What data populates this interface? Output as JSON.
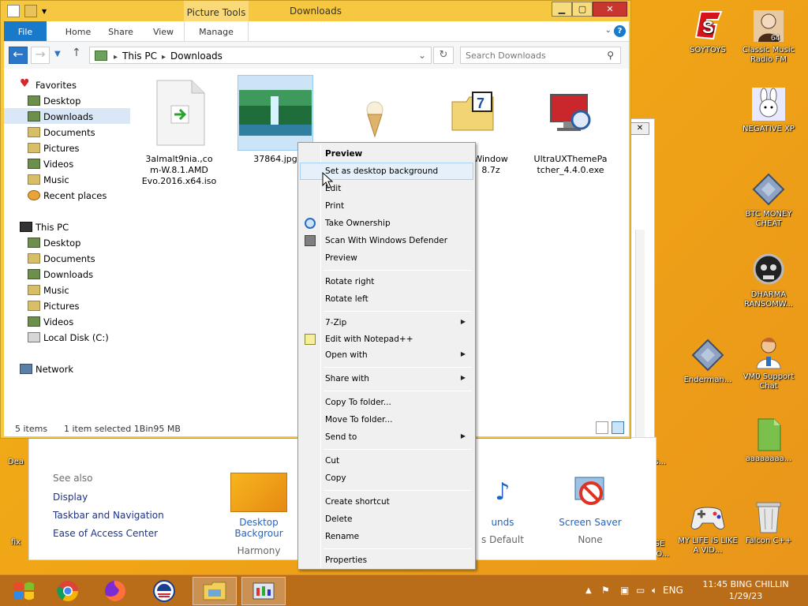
{
  "desktop": {
    "icons": [
      {
        "label": "SOYTOYS",
        "icon": "soytoys-icon"
      },
      {
        "label": "Classic Music Radio FM",
        "icon": "radio-portrait-icon"
      },
      {
        "label": "NEGATIVE XP",
        "icon": "bunny-icon"
      },
      {
        "label": "BTC MONEY CHEAT",
        "icon": "diamond-icon"
      },
      {
        "label": "DHARMA RANSOMW...",
        "icon": "skull-icon"
      },
      {
        "label": "Enderman...",
        "icon": "diamond-icon"
      },
      {
        "label": "VM0 Support Chat",
        "icon": "support-person-icon"
      },
      {
        "label": "aaaaaaaa...",
        "icon": "green-file-icon"
      },
      {
        "label": "MY LIFE IS LIKE A VID...",
        "icon": "gamepad-icon"
      },
      {
        "label": "Falcon C++",
        "icon": "recycle-bin-icon"
      },
      {
        "label": "fix",
        "icon": ""
      },
      {
        "label": "Dea",
        "icon": ""
      },
      {
        "label": "E.s...",
        "icon": ""
      },
      {
        "label": "SE",
        "icon": ""
      },
      {
        "label": "DO...",
        "icon": ""
      }
    ]
  },
  "control_panel": {
    "see_also": "See also",
    "links": [
      "Display",
      "Taskbar and Navigation",
      "Ease of Access Center"
    ],
    "items": [
      {
        "title": "Desktop Backgrour",
        "sub": "Harmony"
      },
      {
        "title": "unds",
        "sub": "s Default"
      },
      {
        "title": "Screen Saver",
        "sub": "None"
      }
    ]
  },
  "explorer": {
    "window_title": "Downloads",
    "contextual_tab_group": "Picture Tools",
    "ribbon_tabs": [
      "File",
      "Home",
      "Share",
      "View",
      "Manage"
    ],
    "address": {
      "root": "This PC",
      "current": "Downloads"
    },
    "search_placeholder": "Search Downloads",
    "nav": {
      "favorites": "Favorites",
      "favorites_items": [
        "Desktop",
        "Downloads",
        "Documents",
        "Pictures",
        "Videos",
        "Music",
        "Recent places"
      ],
      "this_pc": "This PC",
      "this_pc_items": [
        "Desktop",
        "Documents",
        "Downloads",
        "Music",
        "Pictures",
        "Videos",
        "Local Disk (C:)"
      ],
      "network": "Network"
    },
    "files": [
      {
        "name": "3almalt9nia.,co m-W.8.1.AMD Evo.2016.x64.iso",
        "icon": "iso-file-icon"
      },
      {
        "name": "37864.jpg",
        "icon": "waterfall-image-icon"
      },
      {
        "name": "",
        "icon": "ice-cream-image-icon"
      },
      {
        "name": "Window 8.7z",
        "icon": "7zip-archive-icon"
      },
      {
        "name": "UltraUXThemePa tcher_4.4.0.exe",
        "icon": "theme-patcher-icon"
      }
    ],
    "status": {
      "count": "5 items",
      "selected": "1 item selected  1Bin95 MB"
    }
  },
  "context_menu": {
    "groups": [
      [
        {
          "label": "Preview",
          "bold": true
        },
        {
          "label": "Set as desktop background",
          "hover": true
        },
        {
          "label": "Edit"
        },
        {
          "label": "Print"
        },
        {
          "label": "Take Ownership",
          "icon": "ownership-icon"
        },
        {
          "label": "Scan With Windows Defender",
          "icon": "defender-icon"
        },
        {
          "label": "Preview"
        }
      ],
      [
        {
          "label": "Rotate right"
        },
        {
          "label": "Rotate left"
        }
      ],
      [
        {
          "label": "7-Zip",
          "submenu": true
        },
        {
          "label": "Edit with Notepad++",
          "icon": "notepad-plus-icon"
        },
        {
          "label": "Open with",
          "submenu": true
        }
      ],
      [
        {
          "label": "Share with",
          "submenu": true
        }
      ],
      [
        {
          "label": "Copy To folder..."
        },
        {
          "label": "Move To folder..."
        },
        {
          "label": "Send to",
          "submenu": true
        }
      ],
      [
        {
          "label": "Cut"
        },
        {
          "label": "Copy"
        }
      ],
      [
        {
          "label": "Create shortcut"
        },
        {
          "label": "Delete"
        },
        {
          "label": "Rename"
        }
      ],
      [
        {
          "label": "Properties"
        }
      ]
    ]
  },
  "taskbar": {
    "apps": [
      "windows-logo-icon",
      "chrome-icon",
      "firefox-icon",
      "obama-logo-icon",
      "file-explorer-icon",
      "control-panel-icon"
    ],
    "language": "ENG",
    "clock_time": "11:45 BING CHILLIN",
    "clock_date": "1/29/23"
  },
  "colors": {
    "accent": "#1979ca",
    "desktop": "#f0a516",
    "taskbar": "#ba6d18",
    "titlebar": "#f6c842"
  }
}
